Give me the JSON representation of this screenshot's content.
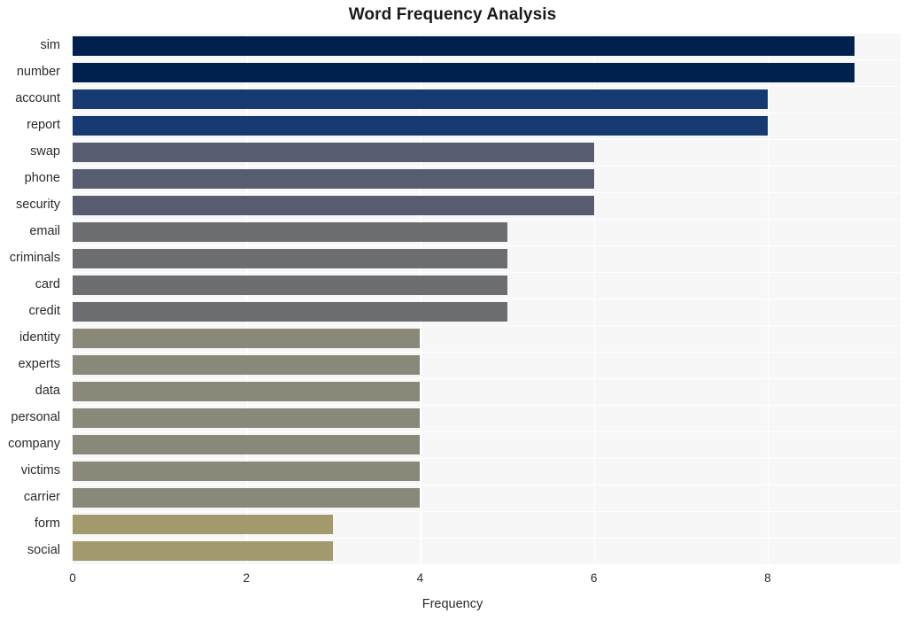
{
  "chart_data": {
    "type": "bar",
    "orientation": "horizontal",
    "title": "Word Frequency Analysis",
    "xlabel": "Frequency",
    "ylabel": "",
    "categories": [
      "sim",
      "number",
      "account",
      "report",
      "swap",
      "phone",
      "security",
      "email",
      "criminals",
      "card",
      "credit",
      "identity",
      "experts",
      "data",
      "personal",
      "company",
      "victims",
      "carrier",
      "form",
      "social"
    ],
    "values": [
      9,
      9,
      8,
      8,
      6,
      6,
      6,
      5,
      5,
      5,
      5,
      4,
      4,
      4,
      4,
      4,
      4,
      4,
      3,
      3
    ],
    "bar_colors": [
      "#00204d",
      "#00214e",
      "#183a72",
      "#183a72",
      "#585c70",
      "#585c70",
      "#585c70",
      "#6b6d71",
      "#6b6d71",
      "#6b6d71",
      "#6b6d71",
      "#8a8878",
      "#8a8878",
      "#8a8878",
      "#8a8878",
      "#8a8878",
      "#8a8878",
      "#8a8878",
      "#a29a6d",
      "#a29a6d"
    ],
    "xticks": [
      0,
      2,
      4,
      6,
      8
    ],
    "xlim": [
      0,
      9.53
    ],
    "grid": true,
    "legend": false,
    "plot_background": "#f7f7f7",
    "figure_background": "#ffffff",
    "gridline_color": "#ffffff",
    "title_color": "#1a1a1a",
    "tick_label_color": "#2b2b2b"
  }
}
